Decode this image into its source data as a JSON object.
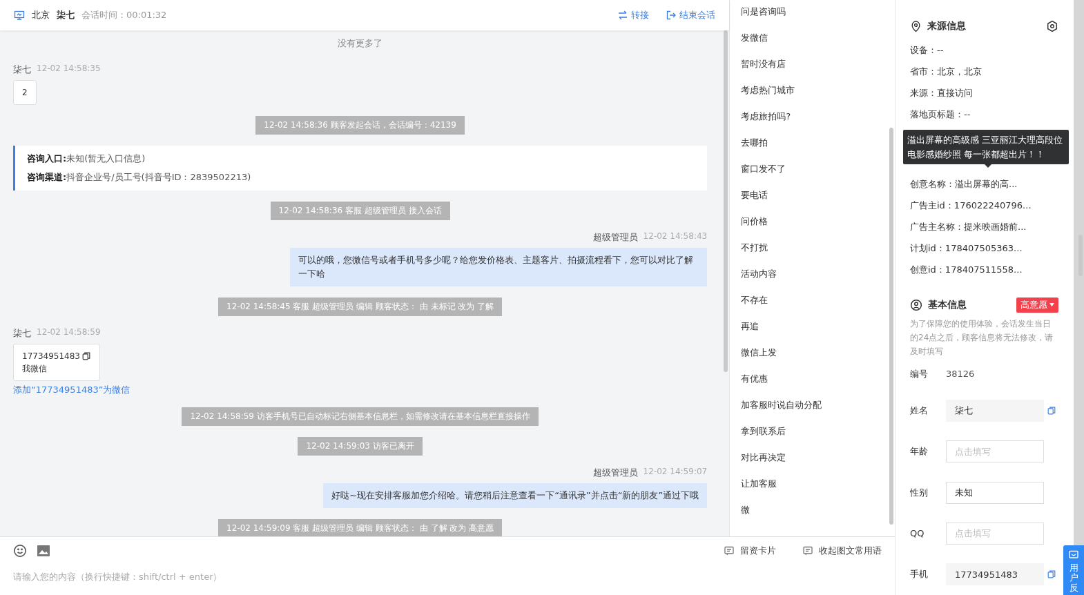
{
  "header": {
    "city": "北京",
    "visitor": "柒七",
    "duration": "会话时间：00:01:32",
    "actions": [
      {
        "kind": "transfer",
        "label": "转接"
      },
      {
        "kind": "end",
        "label": "结束会话"
      }
    ]
  },
  "messages": [
    {
      "kind": "notice",
      "text": "没有更多了"
    },
    {
      "kind": "visitor",
      "name": "柒七",
      "time": "12-02 14:58:35",
      "lines": [
        "2"
      ],
      "copyable": false
    },
    {
      "kind": "system",
      "text": "12-02 14:58:36 顾客发起会话，会话编号：42139"
    },
    {
      "kind": "entry",
      "rows": [
        {
          "label": "咨询入口:",
          "value": "未知(暂无入口信息)"
        },
        {
          "label": "咨询渠道:",
          "value": "抖音企业号/员工号(抖音号ID：2839502213)"
        }
      ]
    },
    {
      "kind": "system",
      "text": "12-02 14:58:36 客服 超级管理员 接入会话"
    },
    {
      "kind": "agent",
      "name": "超级管理员",
      "time": "12-02 14:58:43",
      "text": "可以的哦，您微信号或者手机号多少呢？给您发价格表、主题客片、拍摄流程看下，您可以对比了解一下哈"
    },
    {
      "kind": "system",
      "text": "12-02 14:58:45 客服 超级管理员 编辑 顾客状态： 由 未标记 改为 了解"
    },
    {
      "kind": "visitor",
      "name": "柒七",
      "time": "12-02 14:58:59",
      "lines": [
        "17734951483",
        "我微信"
      ],
      "copyable": true,
      "link": "添加“17734951483”为微信"
    },
    {
      "kind": "system",
      "text": "12-02 14:58:59 访客手机号已自动标记右侧基本信息栏，如需修改请在基本信息栏直接操作"
    },
    {
      "kind": "system",
      "text": "12-02 14:59:03 访客已离开"
    },
    {
      "kind": "agent",
      "name": "超级管理员",
      "time": "12-02 14:59:07",
      "text": "好哒~现在安排客服加您介绍哈。请您稍后注意查看一下“通讯录”并点击“新的朋友”通过下哦"
    },
    {
      "kind": "system",
      "text": "12-02 14:59:09 客服 超级管理员 编辑 顾客状态： 由 了解 改为 高意愿"
    }
  ],
  "composer": {
    "placeholder": "请输入您的内容（换行快捷键：shift/ctrl + enter）",
    "tools": [
      "留资卡片",
      "收起图文常用语"
    ]
  },
  "quick_replies": [
    "问是咨询吗",
    "发微信",
    "暂时没有店",
    "考虑热门城市",
    "考虑旅拍吗?",
    "去哪拍",
    "窗口发不了",
    "要电话",
    "问价格",
    "不打扰",
    "活动内容",
    "不存在",
    "再追",
    "微信上发",
    "有优惠",
    "加客服时说自动分配",
    "拿到联系后",
    "对比再决定",
    "让加客服",
    "微"
  ],
  "source_info": {
    "title": "来源信息",
    "rows_before": [
      "设备：--",
      "省市：北京，北京",
      "来源：直接访问",
      "落地页标题：--"
    ],
    "tooltip": "溢出屏幕的高级感 三亚丽江大理高段位电影感婚纱照 每一张都超出片！！",
    "rows_after": [
      "创意名称：溢出屏幕的高...",
      "广告主id：176022240796...",
      "广告主名称：提米映画婚前...",
      "计划id：178407505363...",
      "创意id：178407511558..."
    ]
  },
  "basic_info": {
    "title": "基本信息",
    "status": "高意愿",
    "note": "为了保障您的使用体验，会话发生当日的24点之后，顾客信息将无法修改，请及时填写",
    "id_label": "编号",
    "id_value": "38126",
    "fields": [
      {
        "label": "姓名",
        "value": "柒七",
        "locked": true,
        "copy": true
      },
      {
        "label": "年龄",
        "placeholder": "点击填写",
        "locked": false,
        "copy": false
      },
      {
        "label": "性别",
        "value": "未知",
        "locked": false,
        "copy": false
      },
      {
        "label": "QQ",
        "placeholder": "点击填写",
        "locked": false,
        "copy": false
      },
      {
        "label": "手机",
        "value": "17734951483",
        "locked": true,
        "copy": true
      }
    ]
  },
  "feedback": {
    "label": "用户反"
  }
}
